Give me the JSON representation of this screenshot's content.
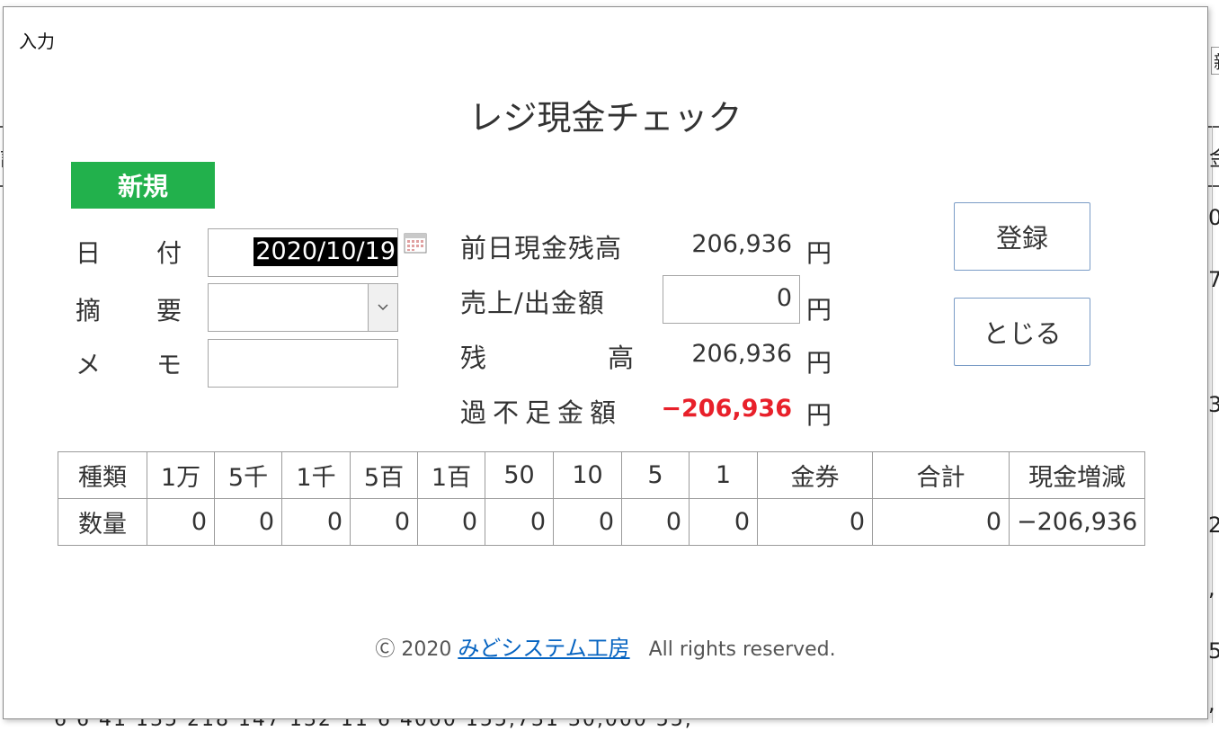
{
  "dialog": {
    "title": "入力"
  },
  "form": {
    "title": "レジ現金チェック",
    "mode_badge": "新規",
    "fields": {
      "date": {
        "label1": "日",
        "label2": "付",
        "value": "2020/10/19"
      },
      "summary": {
        "label1": "摘",
        "label2": "要",
        "value": ""
      },
      "memo": {
        "label1": "メ",
        "label2": "モ",
        "value": ""
      }
    },
    "totals": {
      "prev_balance": {
        "label": "前日現金残高",
        "value": "206,936",
        "unit": "円"
      },
      "sales": {
        "label": "売上/出金額",
        "value": "0",
        "unit": "円"
      },
      "balance": {
        "label1": "残",
        "label2": "高",
        "value": "206,936",
        "unit": "円"
      },
      "diff": {
        "label": "過不足金額",
        "value": "−206,936",
        "unit": "円",
        "color": "#e8202a"
      }
    },
    "buttons": {
      "register": "登録",
      "close": "とじる"
    }
  },
  "count_table": {
    "headers": [
      "種類",
      "1万",
      "5千",
      "1千",
      "5百",
      "1百",
      "50",
      "10",
      "5",
      "1",
      "金券",
      "合計",
      "現金増減"
    ],
    "row_label": "数量",
    "values": [
      "0",
      "0",
      "0",
      "0",
      "0",
      "0",
      "0",
      "0",
      "0",
      "0",
      "0",
      "−206,936"
    ]
  },
  "footer": {
    "copyright": "Ⓒ 2020",
    "company": "みどシステム工房",
    "rights": "All rights reserved."
  },
  "background": {
    "fragments": [
      "新",
      "訂",
      "金",
      "0,",
      "7,",
      "3,",
      "2,",
      ",",
      "5,",
      ","
    ],
    "bottom_row": "6   6   41  135  218  147  132   11    6   4000   155,731   30,000   55,"
  },
  "colors": {
    "badge": "#22b14c",
    "negative": "#e8202a",
    "link": "#0563c1"
  }
}
